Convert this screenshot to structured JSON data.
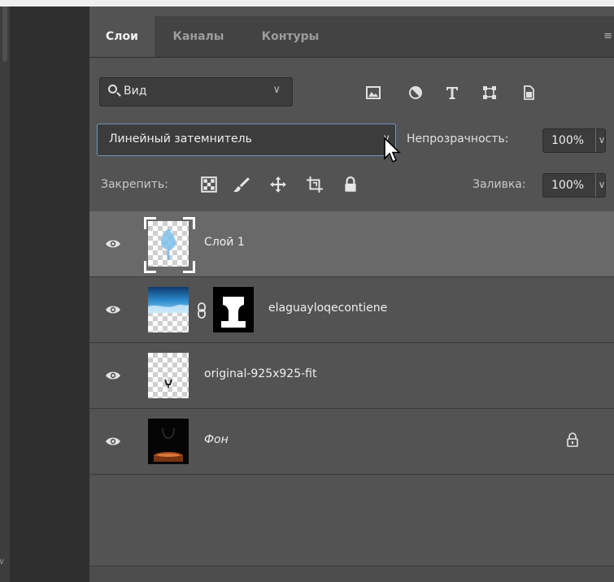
{
  "tabs": [
    "Слои",
    "Каналы",
    "Контуры"
  ],
  "filter": {
    "label": "Вид"
  },
  "blend_mode": {
    "value": "Линейный затемнитель"
  },
  "opacity": {
    "label": "Непрозрачность:",
    "value": "100%"
  },
  "lock": {
    "label": "Закрепить:"
  },
  "fill": {
    "label": "Заливка:",
    "value": "100%"
  },
  "layers": [
    {
      "name": "Слой 1",
      "selected": true,
      "visible": true
    },
    {
      "name": "elaguayloqecontiene",
      "has_mask": true,
      "visible": true
    },
    {
      "name": "original-925x925-fit",
      "visible": true
    },
    {
      "name": "Фон",
      "italic": true,
      "locked": true,
      "visible": true
    }
  ],
  "icons": {
    "filter_types": [
      "image-filter-icon",
      "adjustment-filter-icon",
      "type-filter-icon",
      "shape-filter-icon",
      "smart-object-filter-icon"
    ],
    "lock_types": [
      "lock-transparent-pixels-icon",
      "lock-image-pixels-icon",
      "lock-position-icon",
      "lock-artboard-icon",
      "lock-all-icon"
    ]
  },
  "colors": {
    "panel": "#535353",
    "selected_row": "#696969",
    "accent_border": "#6e93bf"
  }
}
